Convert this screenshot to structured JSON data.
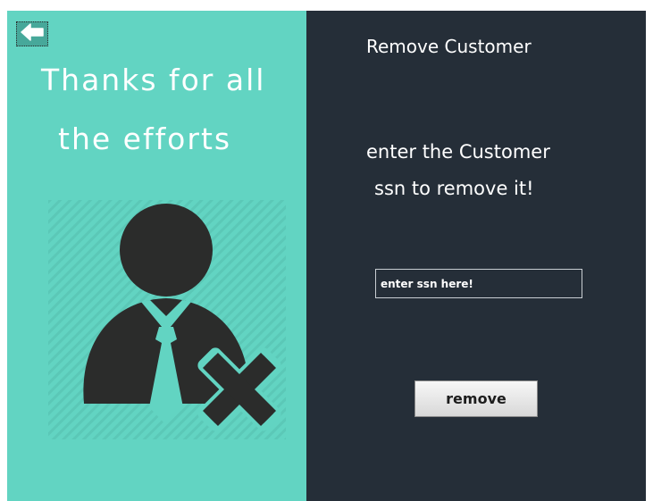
{
  "left_panel": {
    "back_icon": "arrow-left-icon",
    "thanks_line_1": "Thanks for all",
    "thanks_line_2": "the efforts",
    "illustration_icon": "remove-user-icon"
  },
  "right_panel": {
    "title": "Remove Customer",
    "instruction_line_1": "enter the Customer",
    "instruction_line_2": "ssn to remove it!",
    "ssn_input": {
      "value": "enter ssn here!"
    },
    "remove_button_label": "remove"
  },
  "colors": {
    "left_background": "#62d4c2",
    "right_background": "#252e38",
    "illustration_dark": "#2b2c2b",
    "text": "#ffffff"
  }
}
